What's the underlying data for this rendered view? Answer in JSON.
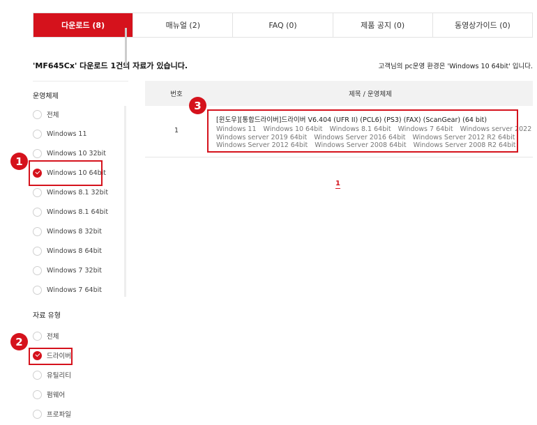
{
  "tabs": [
    {
      "label": "다운로드 (8)",
      "active": true
    },
    {
      "label": "매뉴얼 (2)",
      "active": false
    },
    {
      "label": "FAQ (0)",
      "active": false
    },
    {
      "label": "제품 공지 (0)",
      "active": false
    },
    {
      "label": "동영상가이드 (0)",
      "active": false
    }
  ],
  "headline": "'MF645Cx' 다운로드 1건의 자료가 있습니다.",
  "environment_text": "고객님의 pc운영 환경은 'Windows 10 64bit' 입니다.",
  "sidebar": {
    "os_title": "운영체제",
    "os_options": [
      {
        "label": "전체",
        "checked": false
      },
      {
        "label": "Windows 11",
        "checked": false
      },
      {
        "label": "Windows 10 32bit",
        "checked": false
      },
      {
        "label": "Windows 10 64bit",
        "checked": true
      },
      {
        "label": "Windows 8.1 32bit",
        "checked": false
      },
      {
        "label": "Windows 8.1 64bit",
        "checked": false
      },
      {
        "label": "Windows 8 32bit",
        "checked": false
      },
      {
        "label": "Windows 8 64bit",
        "checked": false
      },
      {
        "label": "Windows 7 32bit",
        "checked": false
      },
      {
        "label": "Windows 7 64bit",
        "checked": false
      }
    ],
    "type_title": "자료 유형",
    "type_options": [
      {
        "label": "전체",
        "checked": false
      },
      {
        "label": "드라이버",
        "checked": true
      },
      {
        "label": "유틸리티",
        "checked": false
      },
      {
        "label": "펌웨어",
        "checked": false
      },
      {
        "label": "프로파일",
        "checked": false
      }
    ]
  },
  "table": {
    "col_no": "번호",
    "col_title": "제목 / 운영체제",
    "rows": [
      {
        "no": "1",
        "title": "[윈도우][통합드라이버]드라이버 V6.404 (UFR II) (PCL6) (PS3) (FAX) (ScanGear) (64 bit)",
        "os": [
          "Windows 11",
          "Windows 10 64bit",
          "Windows 8.1 64bit",
          "Windows 7 64bit",
          "Windows server 2022",
          "Windows server 2019 64bit",
          "Windows Server 2016 64bit",
          "Windows Server 2012 R2 64bit",
          "Windows Server 2012 64bit",
          "Windows Server 2008 64bit",
          "Windows Server 2008 R2 64bit"
        ]
      }
    ]
  },
  "pagination": {
    "current": "1"
  },
  "markers": [
    "1",
    "2",
    "3"
  ],
  "colors": {
    "accent": "#d5121c"
  }
}
